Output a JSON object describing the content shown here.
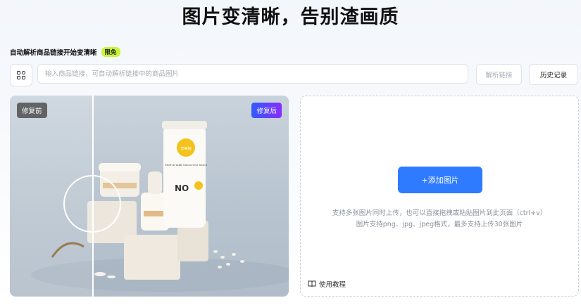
{
  "header": {
    "title": "图片变清晰，告别渣画质"
  },
  "link_section": {
    "subtitle": "自动解析商品链接开始变清晰",
    "badge": "限免",
    "input_placeholder": "输入商品链接，可自动解析链接中的商品图片",
    "parse_button": "解析链接",
    "history_button": "历史记录",
    "grid_icon": "grid-icon"
  },
  "compare": {
    "before_label": "修复前",
    "after_label": "修复后",
    "tube_label_logo": "安美瑞",
    "tube_text": "Melt-in-milk Sunscreen lotion",
    "tube_big": "NO"
  },
  "upload": {
    "add_button": "+添加图片",
    "hint_line1": "支持多张图片同时上传，也可以直接拖拽或粘贴图片到此页面（ctrl+v）",
    "hint_line2": "图片支持png、jpg、jpeg格式，最多支持上传30张图片",
    "tutorial_label": "使用教程",
    "book_icon": "book-icon"
  },
  "colors": {
    "accent": "#2f7bff",
    "badge": "#c8f53a"
  }
}
